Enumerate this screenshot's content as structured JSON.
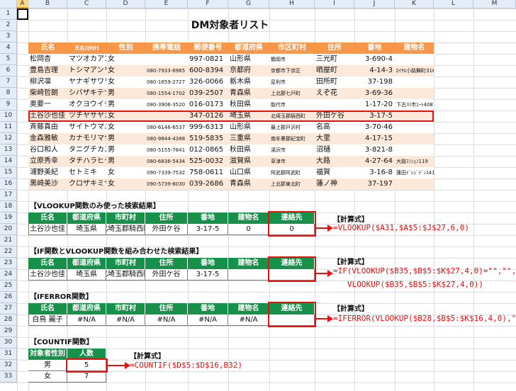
{
  "sheet": {
    "name_box": "A1",
    "columns": [
      "A",
      "B",
      "C",
      "D",
      "E",
      "F",
      "G",
      "H",
      "I",
      "J",
      "K",
      "L",
      "M"
    ],
    "rows": [
      "1",
      "2",
      "3",
      "4",
      "5",
      "6",
      "7",
      "8",
      "9",
      "10",
      "11",
      "12",
      "13",
      "14",
      "15",
      "16",
      "17",
      "18",
      "19",
      "20",
      "21",
      "22",
      "23",
      "24",
      "25",
      "26",
      "27",
      "28",
      "29",
      "30",
      "31",
      "32",
      "33"
    ]
  },
  "title": "DM対象者リスト",
  "master": {
    "headers": [
      "氏名",
      "氏名(ｶﾀｶﾅ)",
      "性別",
      "携帯電話",
      "郵便番号",
      "都道府県",
      "市区町村",
      "住所",
      "番地",
      "建物名"
    ],
    "rows": [
      [
        "松岡杏",
        "マツオカアン",
        "女",
        "",
        "997-0821",
        "山形県",
        "鶴岡市",
        "三光町",
        "3-690-4",
        ""
      ],
      [
        "豊島吉理",
        "トシマアンリ",
        "女",
        "080-7933-6965",
        "600-8394",
        "京都府",
        "京都市下京区",
        "晒屋町",
        "4-14-3",
        "ﾛｲﾔﾙ小路舞町316"
      ],
      [
        "柳沢凛",
        "ヤナギサワリン",
        "女",
        "080-1659-2727",
        "326-0066",
        "栃木県",
        "足利市",
        "田所町",
        "37-198",
        ""
      ],
      [
        "柴崎哲朗",
        "シバザキテツロウ",
        "男",
        "080-1554-1702",
        "039-2507",
        "青森県",
        "上北郡七戸町",
        "えぞ花",
        "3-69-36",
        ""
      ],
      [
        "奥要一",
        "オクヨウイチ",
        "男",
        "080-3906-3520",
        "016-0173",
        "秋田県",
        "能代市",
        "",
        "1-17-20",
        "下古川市ｺｰﾄ408"
      ],
      [
        "土谷沙也佳",
        "ツチヤサヤカ",
        "女",
        "",
        "347-0126",
        "埼玉県",
        "北埼玉郡騎西町",
        "外田ケ谷",
        "3-17-5",
        ""
      ],
      [
        "斉藤真由",
        "サイトウマユ",
        "女",
        "080-6146-6537",
        "999-6313",
        "山形県",
        "最上郡戸沢村",
        "名高",
        "3-70-46",
        ""
      ],
      [
        "金森雅敏",
        "カナモリマサトシ",
        "男",
        "080-9844-4388",
        "519-5835",
        "三重県",
        "南牟婁郡紀宝町",
        "大里",
        "4-17-15",
        ""
      ],
      [
        "谷口和人",
        "タニグチカズト",
        "男",
        "080-5155-7841",
        "012-0865",
        "秋田県",
        "湯沢市",
        "沼樋",
        "3-821-8",
        ""
      ],
      [
        "立原秀幸",
        "タチハラヒデユキ",
        "男",
        "080-6836-5434",
        "525-0032",
        "滋賀県",
        "草津市",
        "大路",
        "4-27-64",
        "大路ﾏﾝｼｮﾝ119"
      ],
      [
        "浦野美紀",
        "セトミキ",
        "女",
        "090-7339-7532",
        "758-0611",
        "山口県",
        "阿武郡阿武町",
        "福賀",
        "3-16-8",
        "蓮田ﾄﾞﾚｼﾞﾃﾞﾝｽ418"
      ],
      [
        "黒崎美沙",
        "クロザキミサ",
        "女",
        "090-5739-6030",
        "039-2686",
        "青森県",
        "上北郡東北町",
        "蓮ノ神",
        "37-197",
        ""
      ]
    ]
  },
  "sec1": {
    "title": "【VLOOKUP関数のみ使った検索結果】",
    "headers": [
      "氏名",
      "都道府県",
      "市町村",
      "住所",
      "番地",
      "建物名",
      "連絡先"
    ],
    "values": [
      "土谷沙也佳",
      "埼玉県",
      "北埼玉郡騎西町",
      "外田ケ谷",
      "3-17-5",
      "0",
      "0"
    ],
    "formula_label": "【計算式】",
    "formula": "=VLOOKUP($A31,$A$5:$J$27,6,0)"
  },
  "sec2": {
    "title": "【IF関数とVLOOKUP関数を組み合わせた検索結果】",
    "headers": [
      "氏名",
      "都道府県",
      "市町村",
      "住所",
      "番地",
      "建物名",
      "連絡先"
    ],
    "values": [
      "土谷沙也佳",
      "埼玉県",
      "北埼玉郡騎西町",
      "外田ケ谷",
      "3-17-5",
      "",
      ""
    ],
    "formula_label": "【計算式】",
    "formula_line1": "=IF(VLOOKUP($B35,$B$5:$K$27,4,0)=\"\",\"\",",
    "formula_line2": "VLOOKUP($B35,$B$5:$K$27,4,0))"
  },
  "sec3": {
    "title": "【IFERROR関数】",
    "headers": [
      "氏名",
      "都道府県",
      "市町村",
      "住所",
      "番地",
      "建物名",
      "連絡先"
    ],
    "values": [
      "白鳥 麗子",
      "#N/A",
      "#N/A",
      "#N/A",
      "#N/A",
      "#N/A",
      ""
    ],
    "formula_label": "【計算式】",
    "formula": "=IFERROR(VLOOKUP($B28,$B$5:$K$16,4,0),\"\")"
  },
  "sec4": {
    "title": "【COUNTIF関数】",
    "headers": [
      "対象者性別",
      "人数"
    ],
    "rows": [
      [
        "男",
        "5"
      ],
      [
        "女",
        "7"
      ]
    ],
    "formula_label": "【計算式】",
    "formula": "=COUNTIF($D$5:$D$16,B32)"
  },
  "colors": {
    "orange_header": "#f79646",
    "orange_band": "#fde9d9",
    "green_header": "#17904a",
    "red_highlight": "#e81010",
    "sheet_header": "#e4ecf7"
  }
}
